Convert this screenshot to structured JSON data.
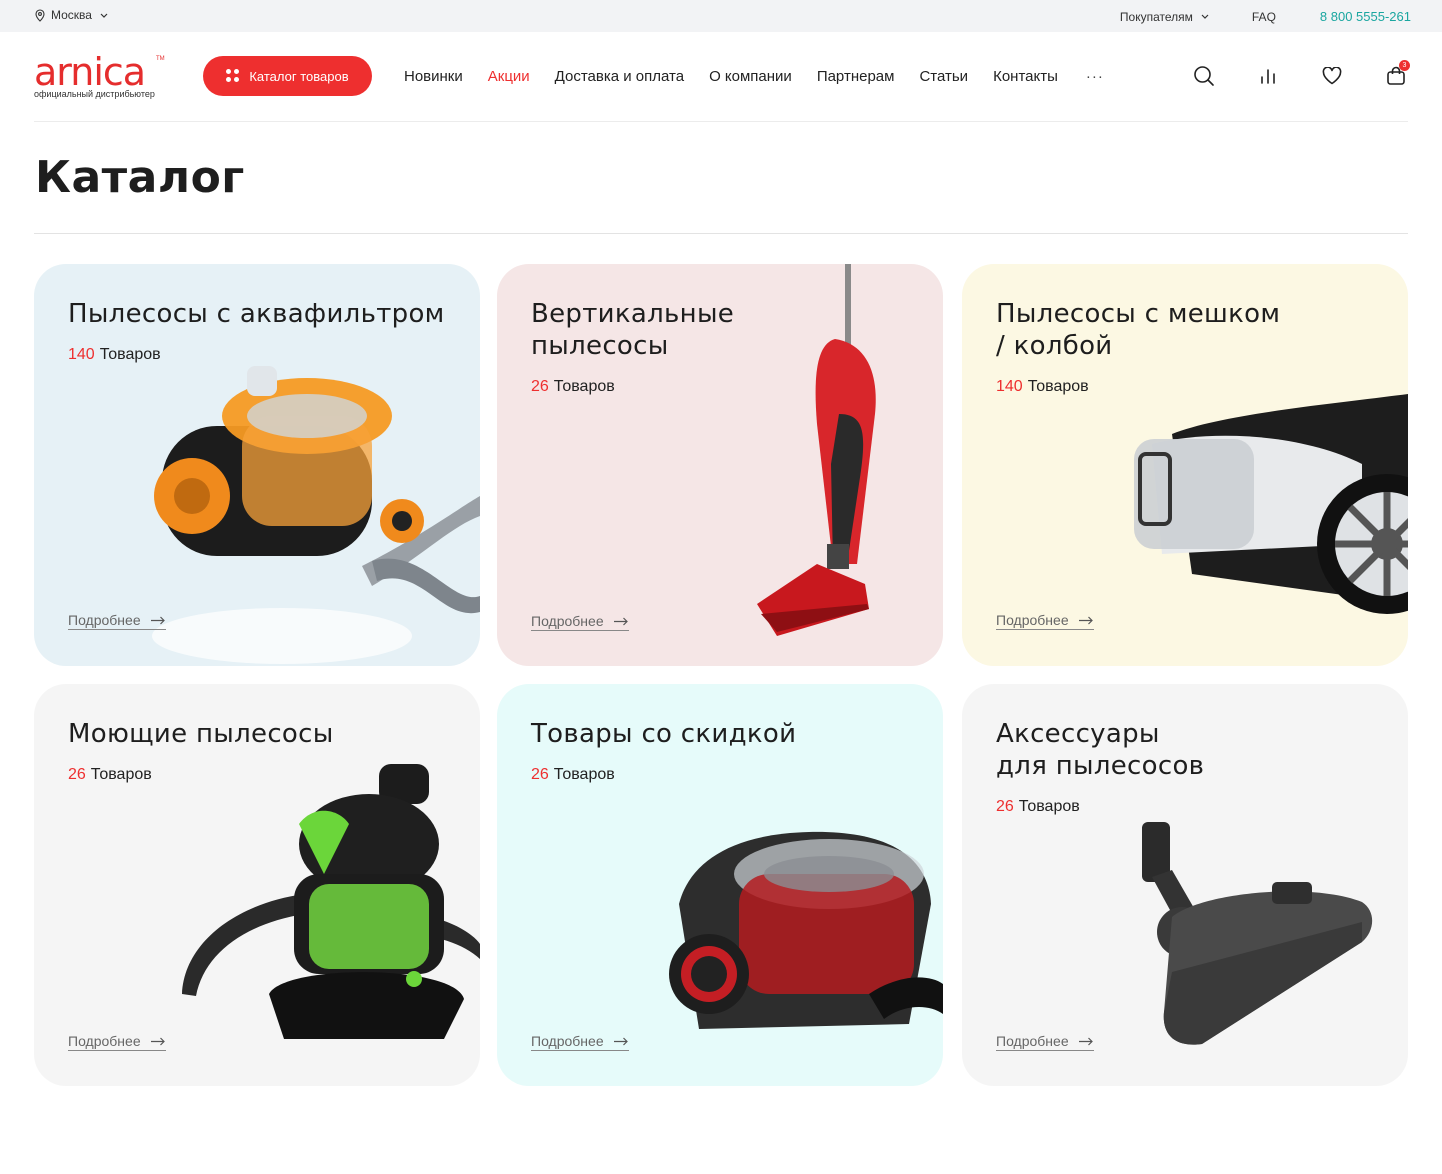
{
  "topbar": {
    "city": "Москва",
    "buyers": "Покупателям",
    "faq": "FAQ",
    "phone": "8 800 5555-261"
  },
  "header": {
    "logo_text": "arnica",
    "logo_tm": "TM",
    "logo_subtitle": "официальный дистрибьютер",
    "catalog_button": "Каталог товаров",
    "nav": [
      "Новинки",
      "Акции",
      "Доставка и оплата",
      "О компании",
      "Партнерам",
      "Статьи",
      "Контакты"
    ],
    "nav_active": "Акции",
    "more": "···",
    "cart_count": "3",
    "icons": [
      "search-icon",
      "compare-icon",
      "heart-icon",
      "cart-icon"
    ]
  },
  "page_title": "Каталог",
  "cards": [
    {
      "title_line1": "Пылесосы с аквафильтром",
      "title_line2": "",
      "count": "140",
      "count_label": "Товаров",
      "more": "Подробнее",
      "bg": "#e6f1f6"
    },
    {
      "title_line1": "Вертикальные",
      "title_line2": "пылесосы",
      "count": "26",
      "count_label": "Товаров",
      "more": "Подробнее",
      "bg": "#f5e6e6"
    },
    {
      "title_line1": "Пылесосы с мешком",
      "title_line2": "/ колбой",
      "count": "140",
      "count_label": "Товаров",
      "more": "Подробнее",
      "bg": "#fcf8e3"
    },
    {
      "title_line1": "Моющие пылесосы",
      "title_line2": "",
      "count": "26",
      "count_label": "Товаров",
      "more": "Подробнее",
      "bg": "#f5f5f5"
    },
    {
      "title_line1": "Товары со скидкой",
      "title_line2": "",
      "count": "26",
      "count_label": "Товаров",
      "more": "Подробнее",
      "bg": "#e6fbfa"
    },
    {
      "title_line1": "Аксессуары",
      "title_line2": "для пылесосов",
      "count": "26",
      "count_label": "Товаров",
      "more": "Подробнее",
      "bg": "#f5f5f5"
    }
  ],
  "colors": {
    "accent": "#ee2f2f",
    "phone": "#1aa6a0"
  }
}
